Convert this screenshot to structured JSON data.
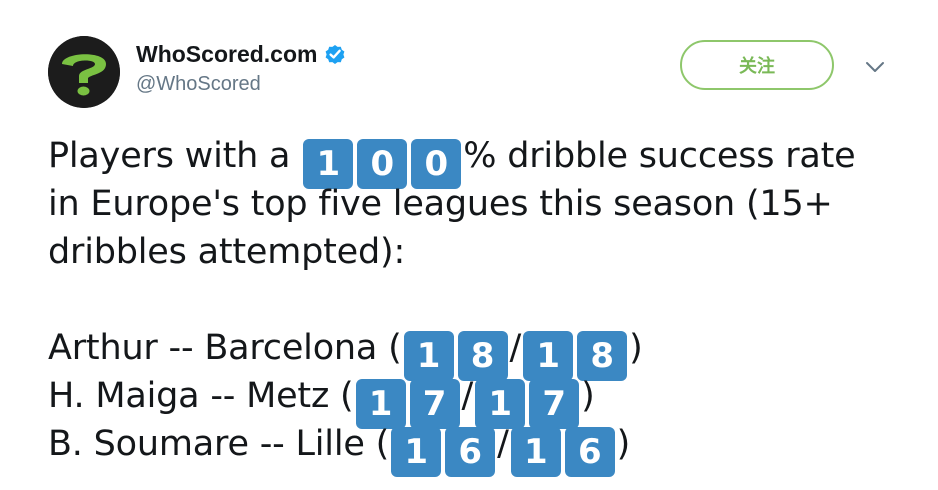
{
  "header": {
    "display_name": "WhoScored.com",
    "handle": "@WhoScored",
    "follow_label": "关注",
    "avatar_icon": "whoscored-question-mark-logo",
    "verified_icon": "verified-badge-icon",
    "menu_icon": "chevron-down-icon"
  },
  "colors": {
    "keycap_blue": "#3b88c3",
    "follow_green": "#7ab957",
    "verified_blue": "#1da1f2",
    "logo_green": "#7ac142"
  },
  "tweet": {
    "line1_prefix": "Players with a ",
    "line1_keycaps": [
      "1",
      "0",
      "0"
    ],
    "line1_suffix": "% dribble success rate",
    "line2": "in Europe's top five leagues this season (15+",
    "line3": "dribbles attempted):",
    "players": [
      {
        "prefix": "Arthur -- Barcelona (",
        "numerator": [
          "1",
          "8"
        ],
        "slash": "/",
        "denominator": [
          "1",
          "8"
        ],
        "suffix": ")"
      },
      {
        "prefix": "H. Maiga -- Metz (",
        "numerator": [
          "1",
          "7"
        ],
        "slash": "/",
        "denominator": [
          "1",
          "7"
        ],
        "suffix": ")"
      },
      {
        "prefix": "B. Soumare -- Lille (",
        "numerator": [
          "1",
          "6"
        ],
        "slash": "/",
        "denominator": [
          "1",
          "6"
        ],
        "suffix": ")"
      }
    ]
  }
}
